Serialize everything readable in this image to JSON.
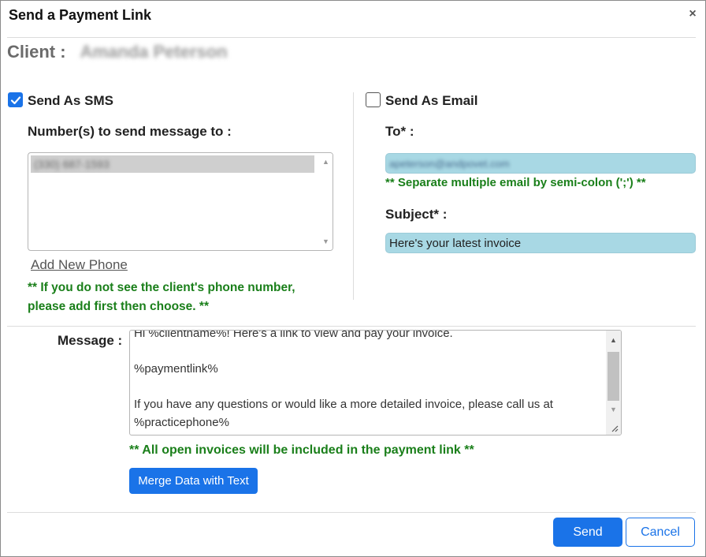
{
  "dialog": {
    "title": "Send a Payment Link",
    "close_symbol": "×"
  },
  "client": {
    "label": "Client :",
    "name": "Amanda Peterson"
  },
  "sms": {
    "checkbox_label": "Send As SMS",
    "checked": true,
    "numbers_label": "Number(s) to send message to :",
    "numbers": [
      "(330) 687-1593"
    ],
    "add_phone_label": "Add New Phone",
    "note_line1": "** If you do not see the client's phone number,",
    "note_line2": "please add first then choose. **"
  },
  "email": {
    "checkbox_label": "Send As Email",
    "checked": false,
    "to_label": "To* :",
    "to_value": "apeterson@andpovet.com",
    "separator_note": "** Separate multiple email by semi-colon (';') **",
    "subject_label": "Subject* :",
    "subject_value": "Here's your latest invoice"
  },
  "message": {
    "label": "Message :",
    "text": "Hi %clientname%! Here's a link to view and pay your invoice.\n\n%paymentlink%\n\nIf you have any questions or would like a more detailed invoice, please call us at %practicephone%",
    "invoices_note": "** All open invoices will be included in the payment link **",
    "merge_button": "Merge Data with Text"
  },
  "footer": {
    "send_button": "Send",
    "cancel_button": "Cancel"
  },
  "colors": {
    "accent": "#1a73e8",
    "note_green": "#1a7f1a",
    "input_fill": "#a8d8e4"
  }
}
